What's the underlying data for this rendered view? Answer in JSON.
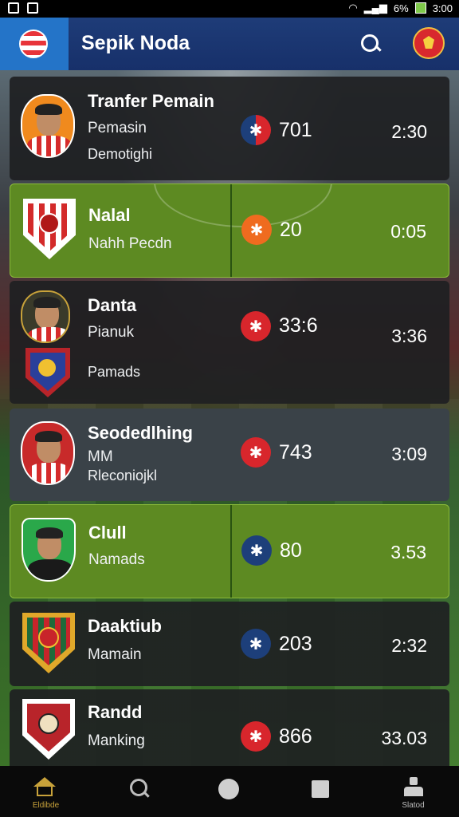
{
  "status_bar": {
    "time": "3:00",
    "battery_text": "6%"
  },
  "app_bar": {
    "title": "Sepik Noda",
    "search_icon": "search-icon",
    "badge_icon": "club-badge-icon"
  },
  "colors": {
    "app_bar": "#1e3c78",
    "logo_box": "#2474c8",
    "green_card": "#5d8a22",
    "accent_red": "#d8262c"
  },
  "rows": [
    {
      "title": "Tranfer Pemain",
      "line1": "Pemasin",
      "line2": "Demotighi",
      "value": "701",
      "time": "2:30"
    },
    {
      "title": "Nalal",
      "line1": "Nahh Pecdn",
      "value": "20",
      "time": "0:05"
    },
    {
      "title": "Danta",
      "line1": "Pianuk",
      "line2": "Pamads",
      "value": "33:6",
      "time": "3:36"
    },
    {
      "title": "Seodedlhing",
      "line1": "MM",
      "line2": "Rleconiojkl",
      "value": "743",
      "time": "3:09"
    },
    {
      "title": "Clull",
      "line1": "Namads",
      "value": "80",
      "time": "3.53"
    },
    {
      "title": "Daaktiub",
      "line1": "Mamain",
      "value": "203",
      "time": "2:32"
    },
    {
      "title": "Randd",
      "line1": "Manking",
      "value": "866",
      "time": "33.03"
    }
  ],
  "bottom_nav": {
    "home_label": "Eldibde",
    "profile_label": "Slatod"
  }
}
